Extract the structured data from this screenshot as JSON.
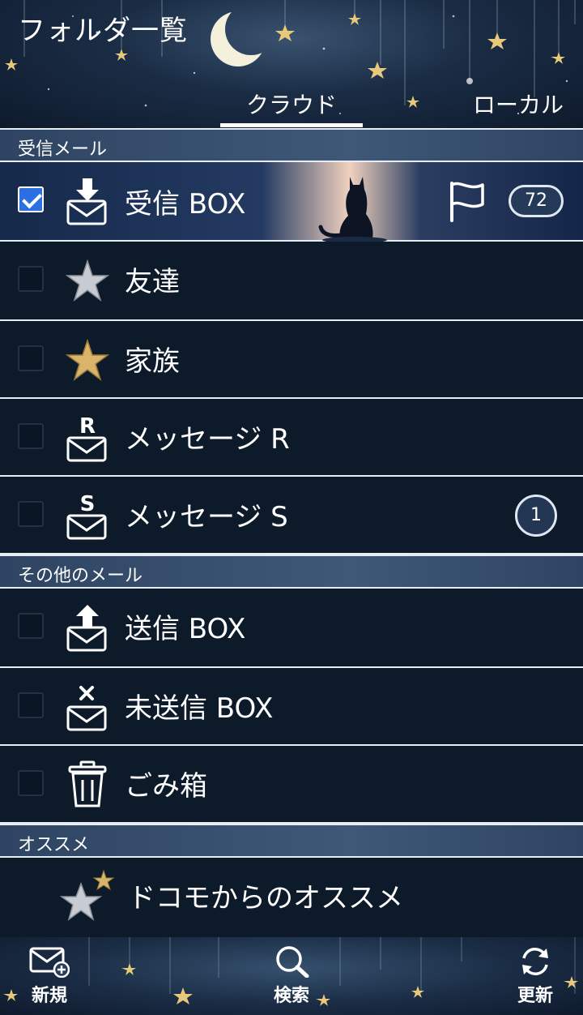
{
  "header": {
    "title": "フォルダ一覧",
    "tabs": [
      {
        "label": "クラウド",
        "active": true
      },
      {
        "label": "ローカル",
        "active": false
      }
    ]
  },
  "sections": {
    "inbox": "受信メール",
    "other": "その他のメール",
    "recommend": "オススメ"
  },
  "folders": [
    {
      "label": "受信 BOX",
      "icon": "inbox-download-icon",
      "checked": true,
      "badge": "72"
    },
    {
      "label": "友達",
      "icon": "silver-star-icon",
      "checked": false,
      "badge": ""
    },
    {
      "label": "家族",
      "icon": "gold-star-icon",
      "checked": false,
      "badge": ""
    },
    {
      "label": "メッセージ R",
      "icon": "message-r-icon",
      "checked": false,
      "badge": ""
    },
    {
      "label": "メッセージ S",
      "icon": "message-s-icon",
      "checked": false,
      "badge": "1"
    },
    {
      "label": "送信 BOX",
      "icon": "outbox-upload-icon",
      "checked": false,
      "badge": ""
    },
    {
      "label": "未送信 BOX",
      "icon": "unsent-mail-icon",
      "checked": false,
      "badge": ""
    },
    {
      "label": "ごみ箱",
      "icon": "trash-icon",
      "checked": false,
      "badge": ""
    },
    {
      "label": "ドコモからのオススメ",
      "icon": "recommend-stars-icon",
      "checked": false,
      "badge": ""
    }
  ],
  "footer": {
    "new_label": "新規",
    "search_label": "検索",
    "refresh_label": "更新"
  },
  "colors": {
    "accent_checkbox": "#2c6fe0",
    "background": "#0c1a2a",
    "divider": "#e6edf5"
  }
}
